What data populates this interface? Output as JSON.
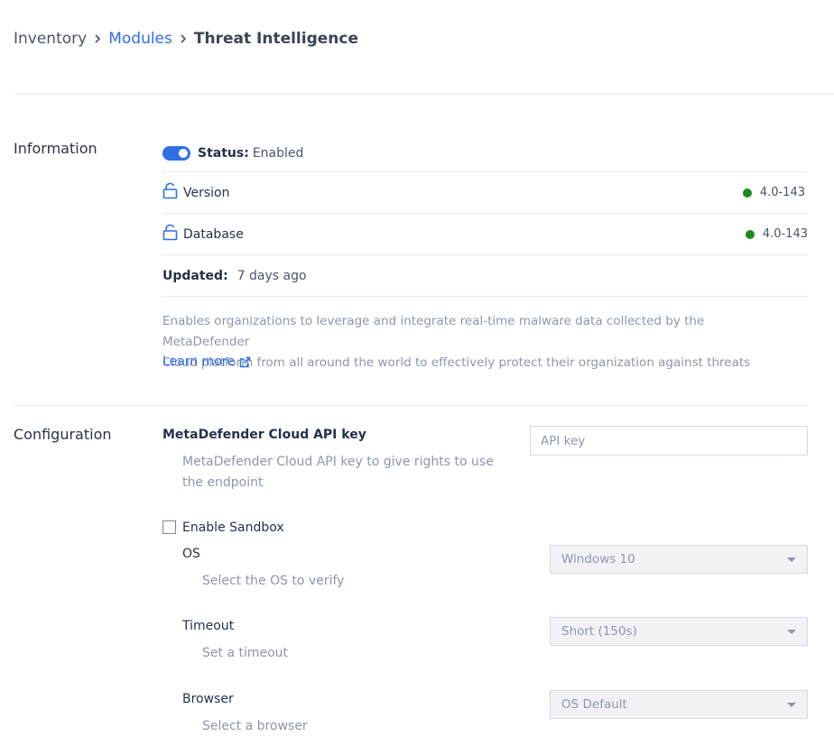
{
  "breadcrumb": {
    "inventory": "Inventory",
    "modules": "Modules",
    "current": "Threat Intelligence"
  },
  "information": {
    "heading": "Information",
    "status_label": "Status:",
    "status_value": "Enabled",
    "status_enabled": true,
    "version_label": "Version",
    "version_value": "4.0-143",
    "database_label": "Database",
    "database_value": "4.0-143",
    "updated_label": "Updated:",
    "updated_value": "7 days ago",
    "description_line1": "Enables organizations to leverage and integrate real-time malware data collected by the MetaDefender",
    "description_line2": "Cloud platform from all around the world to effectively protect their organization against threats",
    "learn_more": "Learn more",
    "status_dot_color": "#1c8a1c"
  },
  "configuration": {
    "heading": "Configuration",
    "api_key_label": "MetaDefender Cloud API key",
    "api_key_help_line1": "MetaDefender Cloud API key to give rights to use",
    "api_key_help_line2": "the endpoint",
    "api_key_placeholder": "API key",
    "api_key_value": "",
    "sandbox_label": "Enable Sandbox",
    "sandbox_checked": false,
    "os_label": "OS",
    "os_help": "Select the OS to verify",
    "os_value": "Windows 10",
    "timeout_label": "Timeout",
    "timeout_help": "Set a timeout",
    "timeout_value": "Short (150s)",
    "browser_label": "Browser",
    "browser_help": "Select a browser",
    "browser_value": "OS Default"
  },
  "colors": {
    "accent": "#2f6fe4",
    "muted_text": "#8d96ab",
    "status_green": "#1c8a1c"
  },
  "icons": {
    "breadcrumb_separator": "chevron-right-icon",
    "version": "unlock-icon",
    "database": "unlock-icon",
    "learn_more": "external-link-icon",
    "select_caret": "caret-down-icon"
  }
}
